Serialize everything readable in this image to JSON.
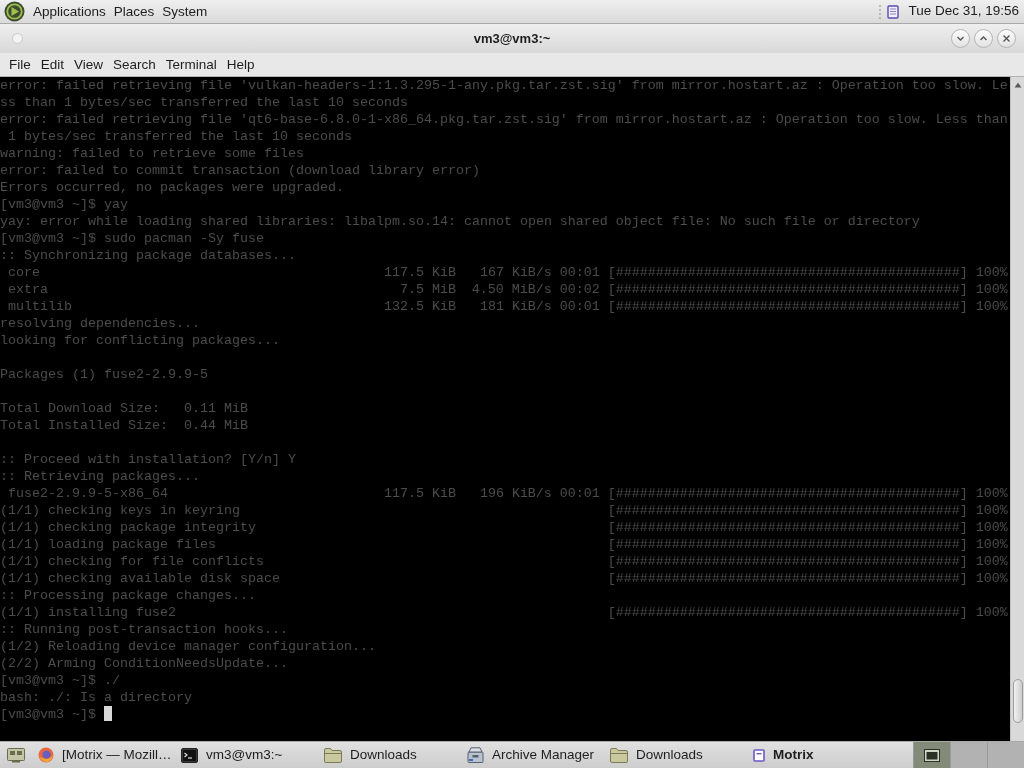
{
  "top_panel": {
    "menus": [
      "Applications",
      "Places",
      "System"
    ],
    "clock": "Tue Dec 31, 19:56"
  },
  "window": {
    "title": "vm3@vm3:~",
    "menu": [
      "File",
      "Edit",
      "View",
      "Search",
      "Terminal",
      "Help"
    ]
  },
  "terminal": {
    "blocks": [
      {
        "lines": [
          {
            "kind": "text",
            "text": "error: failed retrieving file 'vulkan-headers-1:1.3.295-1-any.pkg.tar.zst.sig' from mirror.hostart.az : Operation too slow. Le"
          },
          {
            "kind": "text",
            "text": "ss than 1 bytes/sec transferred the last 10 seconds"
          },
          {
            "kind": "text",
            "text": "error: failed retrieving file 'qt6-base-6.8.0-1-x86_64.pkg.tar.zst.sig' from mirror.hostart.az : Operation too slow. Less than"
          },
          {
            "kind": "text",
            "text": " 1 bytes/sec transferred the last 10 seconds"
          },
          {
            "kind": "text",
            "text": "warning: failed to retrieve some files"
          },
          {
            "kind": "text",
            "text": "error: failed to commit transaction (download library error)"
          },
          {
            "kind": "text",
            "text": "Errors occurred, no packages were upgraded."
          },
          {
            "kind": "text",
            "text": "[vm3@vm3 ~]$ yay"
          },
          {
            "kind": "text",
            "text": "yay: error while loading shared libraries: libalpm.so.14: cannot open shared object file: No such file or directory"
          },
          {
            "kind": "text",
            "text": "[vm3@vm3 ~]$ sudo pacman -Sy fuse"
          },
          {
            "kind": "text",
            "text": ":: Synchronizing package databases..."
          },
          {
            "kind": "download",
            "label": "core",
            "stats": "117.5 KiB   167 KiB/s 00:01",
            "bar": "[###########################################]",
            "percent": "100%"
          },
          {
            "kind": "download",
            "label": "extra",
            "stats": "7.5 MiB  4.50 MiB/s 00:02",
            "bar": "[###########################################]",
            "percent": "100%"
          },
          {
            "kind": "download",
            "label": "multilib",
            "stats": "132.5 KiB   181 KiB/s 00:01",
            "bar": "[###########################################]",
            "percent": "100%"
          },
          {
            "kind": "text",
            "text": "resolving dependencies..."
          },
          {
            "kind": "text",
            "text": "looking for conflicting packages..."
          }
        ]
      },
      {
        "lines": [
          {
            "kind": "text",
            "text": "Packages (1) fuse2-2.9.9-5"
          }
        ]
      },
      {
        "lines": [
          {
            "kind": "text",
            "text": "Total Download Size:   0.11 MiB"
          },
          {
            "kind": "text",
            "text": "Total Installed Size:  0.44 MiB"
          }
        ]
      },
      {
        "lines": [
          {
            "kind": "text",
            "text": ":: Proceed with installation? [Y/n] Y"
          },
          {
            "kind": "text",
            "text": ":: Retrieving packages..."
          },
          {
            "kind": "download",
            "label": "fuse2-2.9.9-5-x86_64",
            "stats": "117.5 KiB   196 KiB/s 00:01",
            "bar": "[###########################################]",
            "percent": "100%"
          },
          {
            "kind": "step",
            "label": "(1/1) checking keys in keyring",
            "bar": "[###########################################]",
            "percent": "100%"
          },
          {
            "kind": "step",
            "label": "(1/1) checking package integrity",
            "bar": "[###########################################]",
            "percent": "100%"
          },
          {
            "kind": "step",
            "label": "(1/1) loading package files",
            "bar": "[###########################################]",
            "percent": "100%"
          },
          {
            "kind": "step",
            "label": "(1/1) checking for file conflicts",
            "bar": "[###########################################]",
            "percent": "100%"
          },
          {
            "kind": "step",
            "label": "(1/1) checking available disk space",
            "bar": "[###########################################]",
            "percent": "100%"
          },
          {
            "kind": "text",
            "text": ":: Processing package changes..."
          },
          {
            "kind": "step",
            "label": "(1/1) installing fuse2",
            "bar": "[###########################################]",
            "percent": "100%"
          },
          {
            "kind": "text",
            "text": ":: Running post-transaction hooks..."
          },
          {
            "kind": "text",
            "text": "(1/2) Reloading device manager configuration..."
          },
          {
            "kind": "text",
            "text": "(2/2) Arming ConditionNeedsUpdate..."
          },
          {
            "kind": "text",
            "text": "[vm3@vm3 ~]$ ./"
          },
          {
            "kind": "text",
            "text": "bash: ./: Is a directory"
          },
          {
            "kind": "text",
            "text": "[vm3@vm3 ~]$",
            "cursor": true
          }
        ]
      }
    ]
  },
  "taskbar": {
    "tasks": [
      {
        "kind": "browser",
        "label": "[Motrix — Mozill…",
        "selected": false,
        "attention": false
      },
      {
        "kind": "terminal",
        "label": "vm3@vm3:~",
        "selected": false,
        "attention": false
      },
      {
        "kind": "folder",
        "label": "Downloads",
        "selected": false,
        "attention": false
      },
      {
        "kind": "archive",
        "label": "Archive Manager",
        "selected": false,
        "attention": false
      },
      {
        "kind": "folder",
        "label": "Downloads",
        "selected": false,
        "attention": false
      },
      {
        "kind": "app",
        "label": "Motrix",
        "selected": false,
        "attention": true
      }
    ],
    "workspaces": [
      {
        "selected": true
      },
      {
        "selected": false
      },
      {
        "selected": false
      }
    ]
  }
}
